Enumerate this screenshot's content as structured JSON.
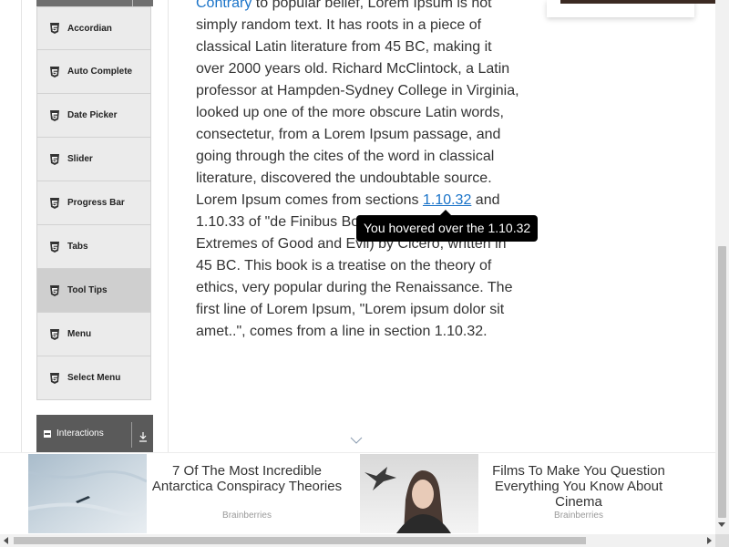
{
  "sidebar": {
    "items": [
      {
        "label": "Accordian",
        "icon": "html5-icon",
        "active": false
      },
      {
        "label": "Auto Complete",
        "icon": "html5-icon",
        "active": false
      },
      {
        "label": "Date Picker",
        "icon": "html5-icon",
        "active": false
      },
      {
        "label": "Slider",
        "icon": "html5-icon",
        "active": false
      },
      {
        "label": "Progress Bar",
        "icon": "html5-icon",
        "active": false
      },
      {
        "label": "Tabs",
        "icon": "html5-icon",
        "active": false
      },
      {
        "label": "Tool Tips",
        "icon": "html5-icon",
        "active": true
      },
      {
        "label": "Menu",
        "icon": "html5-icon",
        "active": false
      },
      {
        "label": "Select Menu",
        "icon": "html5-icon",
        "active": false
      }
    ],
    "section": {
      "label": "Interactions",
      "icon": "minus-icon",
      "toggle_icon": "download-icon"
    }
  },
  "content": {
    "link1": "Contrary",
    "text1": " to popular belief, Lorem Ipsum is not simply random text. It has roots in a piece of classical Latin literature from 45 BC, making it over 2000 years old. Richard McClintock, a Latin professor at Hampden-Sydney College in Virginia, looked up one of the more obscure Latin words, consectetur, from a Lorem Ipsum passage, and going through the cites of the word in classical literature, discovered the undoubtable source. Lorem Ipsum comes from sections ",
    "link2": "1.10.32",
    "text2": " and 1.10.33 of \"de Finibus Bonorum et Malorum\" (The Extremes of Good and Evil) by Cicero, written in 45 BC. This book is a treatise on the theory of ethics, very popular during the Renaissance. The first line of Lorem Ipsum, \"Lorem ipsum dolor sit amet..\", comes from a line in section 1.10.32."
  },
  "tooltip": {
    "text": "You hovered over the 1.10.32"
  },
  "ads": [
    {
      "title": "7 Of The Most Incredible Antarctica Conspiracy Theories",
      "source": "Brainberries",
      "image": "antarctica-ice-photo"
    },
    {
      "title": "Films To Make You Question Everything You Know About Cinema",
      "source": "Brainberries",
      "image": "woman-with-bird-photo"
    }
  ],
  "colors": {
    "link": "#1a73c8",
    "tooltip_bg": "#000000",
    "menu_item_bg": "#ebebeb",
    "menu_item_active_bg": "#cfcfcf",
    "section_bg": "#5a5a5a"
  }
}
